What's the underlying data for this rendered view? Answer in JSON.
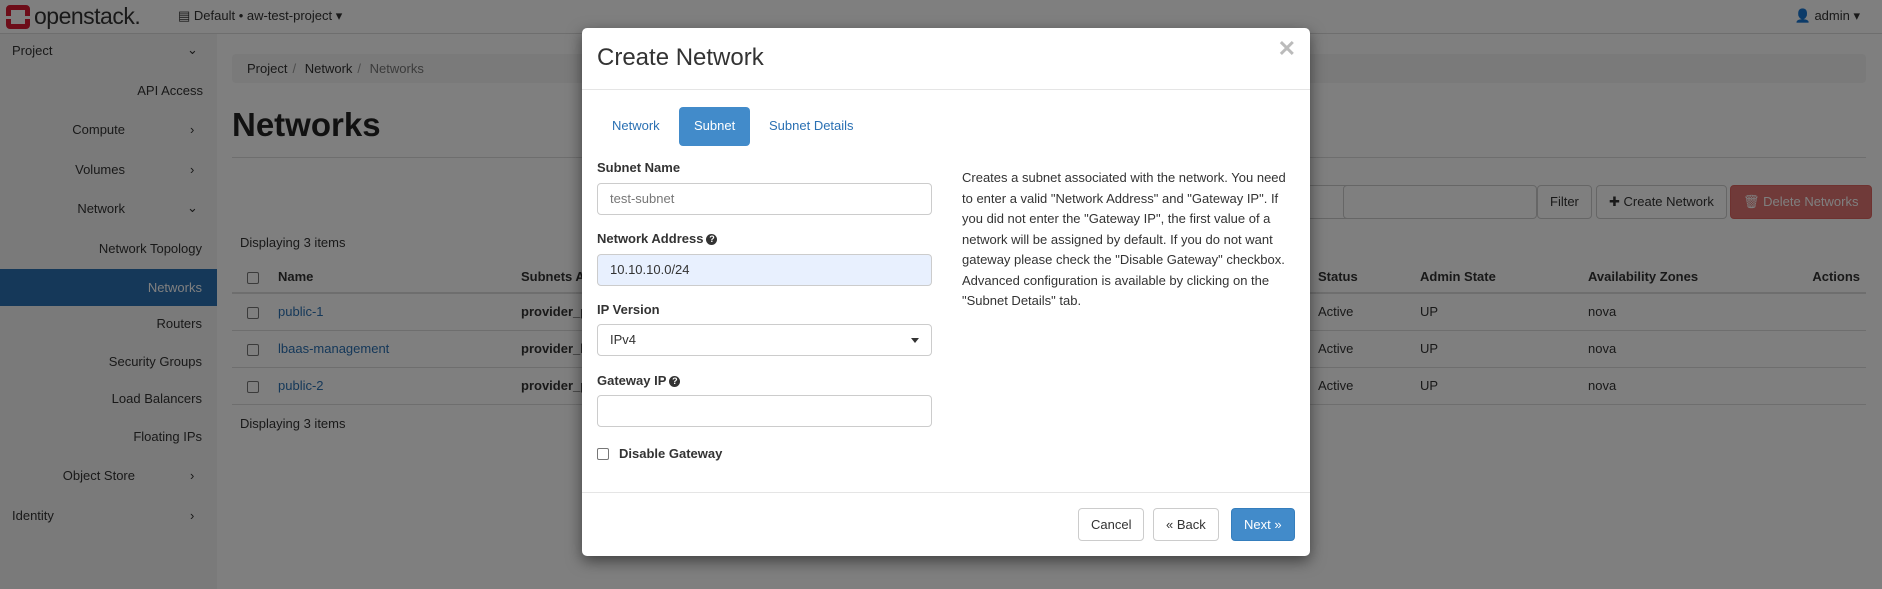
{
  "topbar": {
    "logo_text": "openstack.",
    "project_selector": "Default • aw-test-project",
    "user": "admin"
  },
  "sidebar": {
    "items": [
      {
        "label": "Project",
        "chevron": "down"
      },
      {
        "label": "API Access"
      },
      {
        "label": "Compute",
        "chevron": "right"
      },
      {
        "label": "Volumes",
        "chevron": "right"
      },
      {
        "label": "Network",
        "chevron": "down"
      },
      {
        "label": "Network Topology"
      },
      {
        "label": "Networks",
        "active": true
      },
      {
        "label": "Routers"
      },
      {
        "label": "Security Groups"
      },
      {
        "label": "Load Balancers"
      },
      {
        "label": "Floating IPs"
      },
      {
        "label": "Object Store",
        "chevron": "right"
      },
      {
        "label": "Identity",
        "chevron": "right"
      }
    ]
  },
  "main": {
    "breadcrumb": [
      "Project",
      "Network",
      "Networks"
    ],
    "title": "Networks",
    "toolbar": {
      "filter": "Filter",
      "create": "Create Network",
      "delete": "Delete Networks"
    },
    "displaying": "Displaying 3 items",
    "table": {
      "headers": [
        "Name",
        "Subnets As",
        "Status",
        "Admin State",
        "Availability Zones",
        "Actions"
      ],
      "rows": [
        {
          "name": "public-1",
          "subnets": "provider_p",
          "status": "Active",
          "admin": "UP",
          "az": "nova"
        },
        {
          "name": "lbaas-management",
          "subnets": "provider_lb",
          "status": "Active",
          "admin": "UP",
          "az": "nova"
        },
        {
          "name": "public-2",
          "subnets": "provider_p",
          "status": "Active",
          "admin": "UP",
          "az": "nova"
        }
      ]
    }
  },
  "modal": {
    "title": "Create Network",
    "tabs": [
      "Network",
      "Subnet",
      "Subnet Details"
    ],
    "active_tab": "Subnet",
    "fields": {
      "subnet_name_label": "Subnet Name",
      "subnet_name_placeholder": "test-subnet",
      "network_address_label": "Network Address",
      "network_address_value": "10.10.10.0/24",
      "ip_version_label": "IP Version",
      "ip_version_value": "IPv4",
      "gateway_ip_label": "Gateway IP",
      "gateway_ip_value": "",
      "disable_gateway_label": "Disable Gateway"
    },
    "help": "Creates a subnet associated with the network. You need to enter a valid \"Network Address\" and \"Gateway IP\". If you did not enter the \"Gateway IP\", the first value of a network will be assigned by default. If you do not want gateway please check the \"Disable Gateway\" checkbox. Advanced configuration is available by clicking on the \"Subnet Details\" tab.",
    "buttons": {
      "cancel": "Cancel",
      "back": "« Back",
      "next": "Next »"
    }
  },
  "colors": {
    "brand": "#da1a32",
    "primary": "#428bca",
    "danger": "#d9534f",
    "active_nav": "#2a70b3"
  }
}
